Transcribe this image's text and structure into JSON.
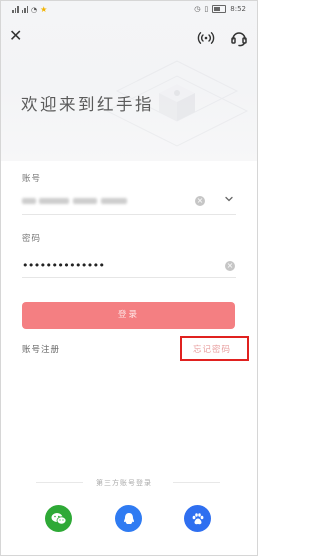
{
  "status_bar": {
    "time": "8:52"
  },
  "welcome_text": "欢迎来到红手指",
  "account": {
    "label": "账号"
  },
  "password": {
    "label": "密码",
    "value": "••••••••••••••"
  },
  "login_label": "登录",
  "register_label": "账号注册",
  "forgot_label": "忘记密码",
  "third_party": {
    "title": "第三方账号登录"
  },
  "colors": {
    "primary": "#f47f82",
    "highlight": "#e0211f",
    "wechat": "#2ea936",
    "qq": "#2f7bf2",
    "baidu": "#2f6ff0"
  },
  "icons": {
    "close": "close-icon",
    "nfc": "nfc-icon",
    "service": "customer-service-icon",
    "clear": "clear-icon",
    "dropdown": "chevron-down-icon",
    "wechat": "wechat-icon",
    "qq": "qq-icon",
    "baidu": "baidu-icon"
  }
}
